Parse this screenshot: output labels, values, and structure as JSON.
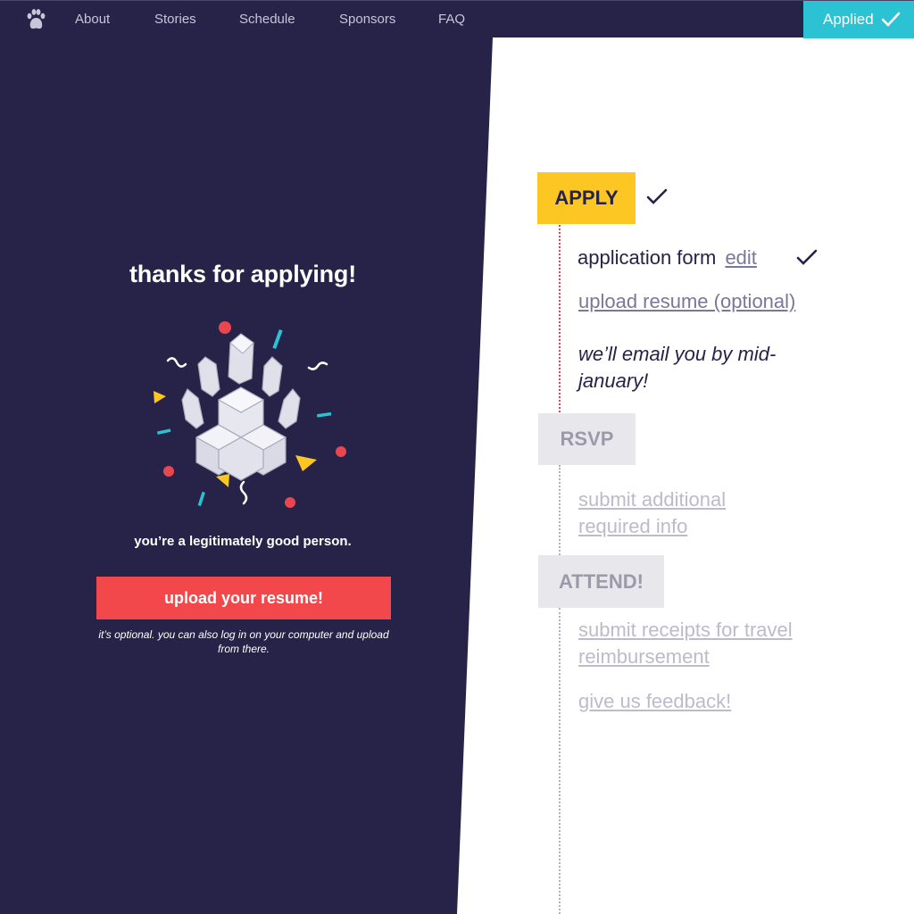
{
  "nav": {
    "items": [
      "About",
      "Stories",
      "Schedule",
      "Sponsors",
      "FAQ"
    ],
    "applied_label": "Applied",
    "logo_icon": "paw-icon"
  },
  "confirmation": {
    "heading": "thanks for applying!",
    "subtext": "you’re a legitimately good person.",
    "upload_button": "upload your resume!",
    "note": "it’s optional. you can also log in on your computer and upload from there."
  },
  "timeline": {
    "apply": {
      "label": "APPLY",
      "application_form": "application form",
      "edit_link": "edit",
      "upload_resume": "upload resume (optional)",
      "email_note": "we’ll email you by mid-january!"
    },
    "rsvp": {
      "label": "RSVP",
      "submit_info": "submit additional required info"
    },
    "attend": {
      "label": "ATTEND!",
      "receipts": "submit receipts for travel reimbursement",
      "feedback": "give us feedback!"
    }
  },
  "colors": {
    "dark": "#272247",
    "accent_yellow": "#fcc623",
    "accent_red": "#f2484c",
    "accent_cyan": "#2bc2d4",
    "muted": "#bdbbc9"
  }
}
